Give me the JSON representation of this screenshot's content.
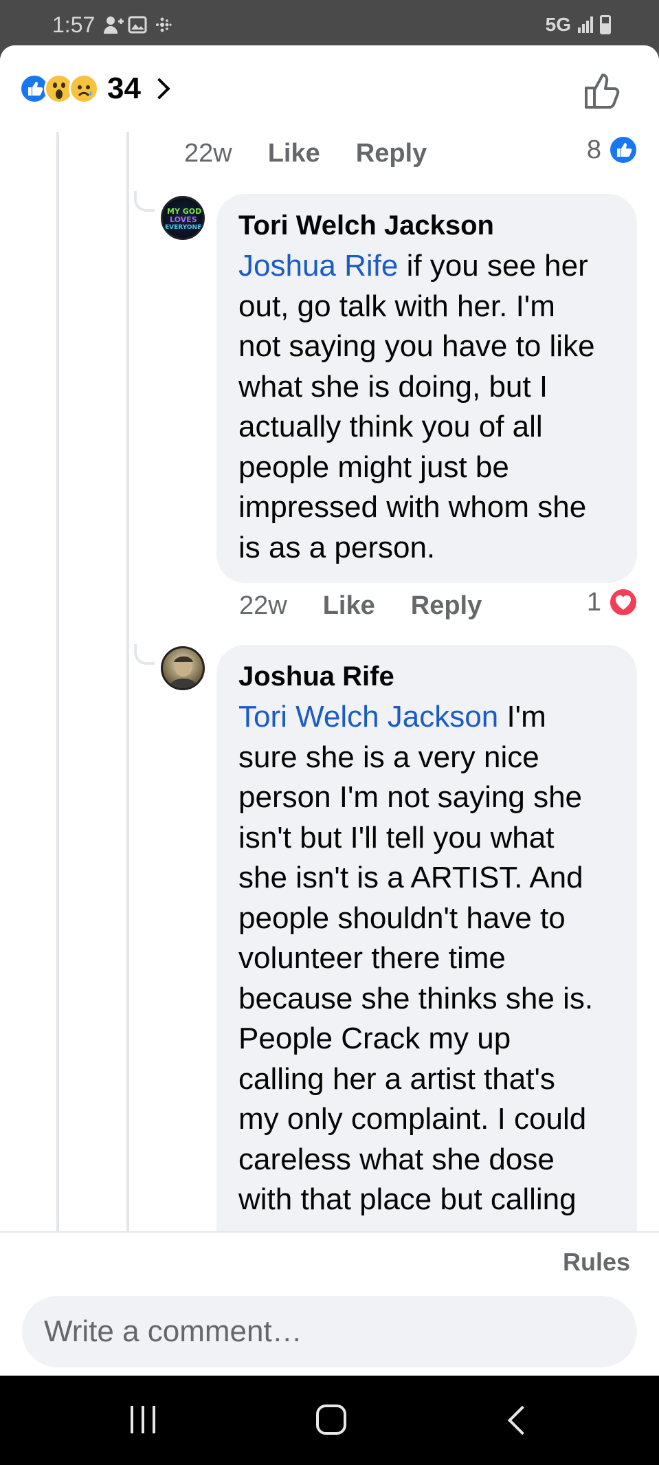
{
  "status_bar": {
    "time": "1:57",
    "network": "5G",
    "icons": [
      "add-person-icon",
      "image-icon",
      "fitbit-icon",
      "signal-icon",
      "battery-icon"
    ]
  },
  "header": {
    "reactions": [
      "like",
      "wow",
      "sad"
    ],
    "reaction_count": "34",
    "icons": [
      "chevron-right-icon",
      "thumbs-up-outline-icon"
    ]
  },
  "thread": {
    "top_meta": {
      "time": "22w",
      "like_label": "Like",
      "reply_label": "Reply",
      "reaction_count": "8",
      "reaction_type": "like"
    },
    "comments": [
      {
        "author": "Tori Welch Jackson",
        "mention": "Joshua Rife",
        "lines": [
          " if you see her",
          "out, go talk with her. I'm",
          "not saying you have to like",
          "what she is doing, but I",
          "actually think you of all",
          "people might just be",
          "impressed with whom she",
          "is as a person."
        ],
        "avatar_text": [
          "MY GOD",
          "LOVES",
          "EVERYONE"
        ],
        "meta": {
          "time": "22w",
          "like_label": "Like",
          "reply_label": "Reply",
          "reaction_count": "1",
          "reaction_type": "love"
        }
      },
      {
        "author": "Joshua Rife",
        "mention": "Tori Welch Jackson",
        "lines": [
          " I'm",
          "sure she is a very nice",
          "person I'm not saying she",
          "isn't but I'll tell you what",
          "she isn't is a ARTIST. And",
          "people shouldn't have to",
          "volunteer there time",
          "because she thinks she is.",
          "People Crack my up",
          "calling her a artist that's",
          "my only complaint. I could",
          "careless what she dose",
          "with that place but calling"
        ]
      }
    ]
  },
  "composer": {
    "rules_label": "Rules",
    "placeholder": "Write a comment…"
  },
  "nav": {
    "icons": [
      "recent-apps-icon",
      "home-icon",
      "back-icon"
    ]
  },
  "colors": {
    "facebook_blue": "#1877f2",
    "mention_blue": "#1a5bc4",
    "love_red": "#f33e58",
    "bubble_gray": "#f0f2f5"
  }
}
